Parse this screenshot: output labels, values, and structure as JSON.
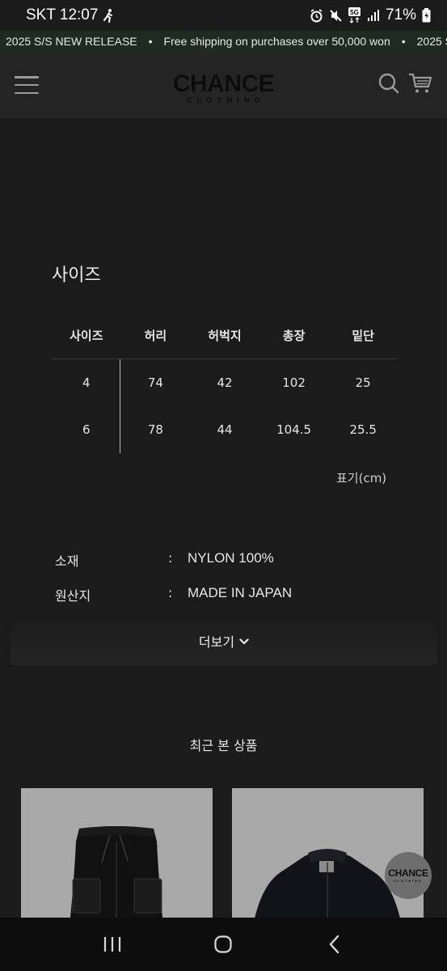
{
  "status_bar": {
    "carrier_time": "SKT 12:07",
    "battery": "71%",
    "network": "5G"
  },
  "marquee": {
    "items": [
      "2025 S/S NEW RELEASE",
      "Free shipping on purchases over 50,000 won",
      "2025 S/S"
    ],
    "separator": "•"
  },
  "header": {
    "logo_main": "CHANCE",
    "logo_sub": "CLOTHING"
  },
  "size_section": {
    "title": "사이즈",
    "columns": [
      "사이즈",
      "허리",
      "허벅지",
      "총장",
      "밑단"
    ],
    "rows": [
      [
        "4",
        "74",
        "42",
        "102",
        "25"
      ],
      [
        "6",
        "78",
        "44",
        "104.5",
        "25.5"
      ]
    ],
    "unit_note": "표기(cm)"
  },
  "specs": [
    {
      "label": "소재",
      "colon": ":",
      "value": "NYLON 100%"
    },
    {
      "label": "원산지",
      "colon": ":",
      "value": "MADE IN JAPAN"
    }
  ],
  "more_button": {
    "label": "더보기"
  },
  "recent": {
    "title": "최근 본 상품"
  },
  "float_logo": {
    "main": "CHANCE",
    "sub": "CLOTHING"
  },
  "colors": {
    "background": "#1b1b1b",
    "header": "#242424",
    "marquee_bg": "#1e2a22",
    "product_bg": "#a9a9a9"
  }
}
